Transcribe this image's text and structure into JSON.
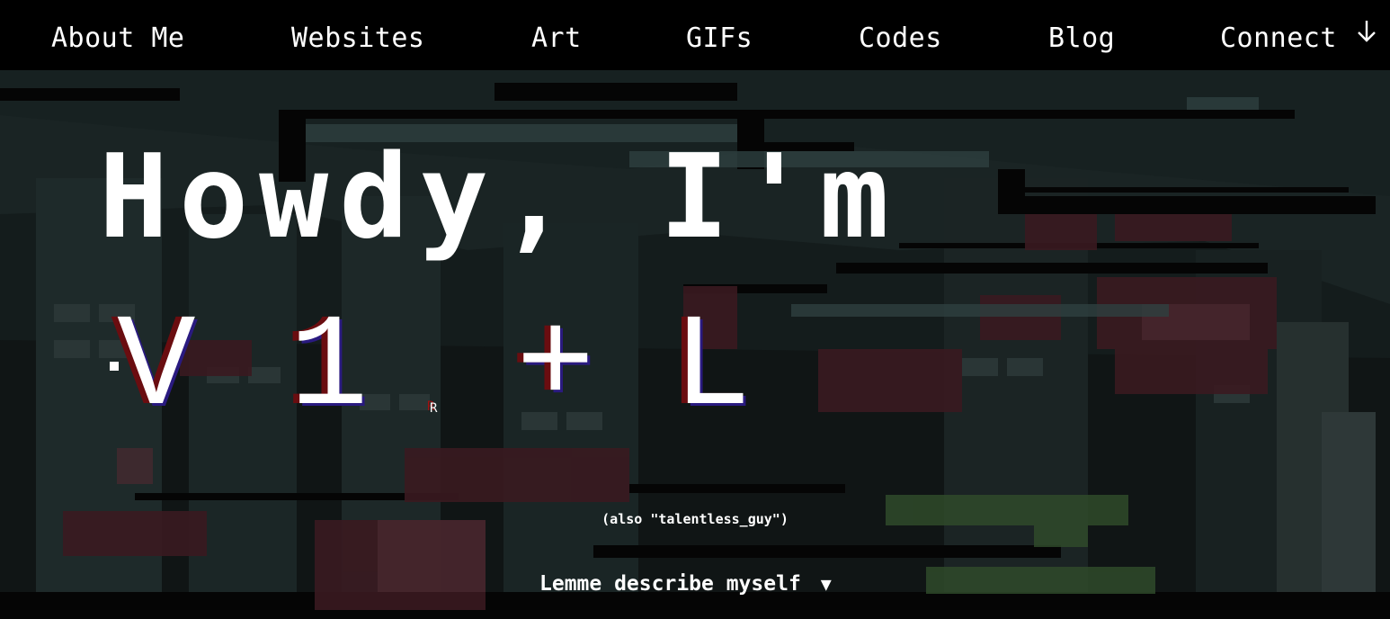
{
  "nav": {
    "items": [
      {
        "label": "About Me"
      },
      {
        "label": "Websites"
      },
      {
        "label": "Art"
      },
      {
        "label": "GIFs"
      },
      {
        "label": "Codes"
      },
      {
        "label": "Blog"
      },
      {
        "label": "Connect"
      }
    ],
    "connect_icon": "arrow-down-icon"
  },
  "hero": {
    "greeting": "Howdy, I'm",
    "name_glyphs": [
      "V",
      "1",
      "+",
      "L"
    ],
    "glitch_fragment": "R",
    "alias": "(also \"talentless_guy\")",
    "describe_label": "Lemme describe myself",
    "describe_arrow": "▼"
  },
  "colors": {
    "background": "#000000",
    "glitch_red": "#6a0d10",
    "glitch_blue": "#2a1a80",
    "text": "#ffffff"
  }
}
